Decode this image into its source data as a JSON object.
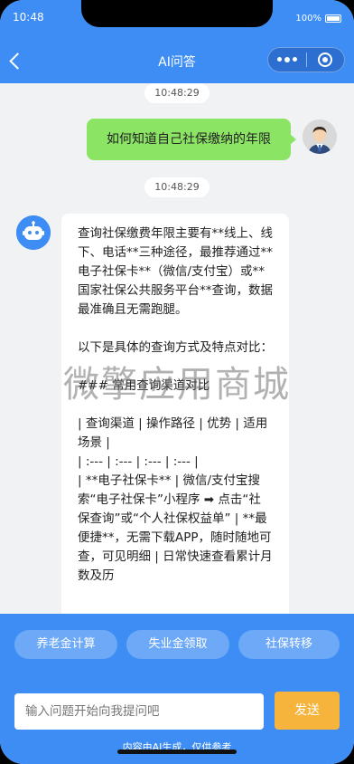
{
  "status": {
    "time": "10:48",
    "battery": "100%"
  },
  "nav": {
    "title": "AI问答"
  },
  "chat": {
    "time1": "10:48:29",
    "user_message": "如何知道自己社保缴纳的年限",
    "time2": "10:48:29",
    "bot_message": "查询社保缴费年限主要有**线上、线下、电话**三种途径，最推荐通过**电子社保卡**（微信/支付宝）或**国家社保公共服务平台**查询，数据最准确且无需跑腿。\n\n以下是具体的查询方式及特点对比：\n\n### 常用查询渠道对比\n\n| 查询渠道 | 操作路径 | 优势 | 适用场景 |\n| :--- | :--- | :--- | :--- |\n| **电子社保卡** | 微信/支付宝搜索“电子社保卡”小程序 ➡ 点击“社保查询”或“个人社保权益单” | **最便捷**，无需下载APP，随时随地可查，可见明细 | 日常快速查看累计月数及历"
  },
  "watermark": "微擎应用商城",
  "quick_actions": [
    "养老金计算",
    "失业金领取",
    "社保转移"
  ],
  "input": {
    "placeholder": "输入问题开始向我提问吧"
  },
  "send_label": "发送",
  "disclaimer": "内容由AI生成，仅供参考",
  "colors": {
    "primary": "#3d8df5",
    "user_bubble": "#8ce465",
    "send": "#f6b43c"
  }
}
